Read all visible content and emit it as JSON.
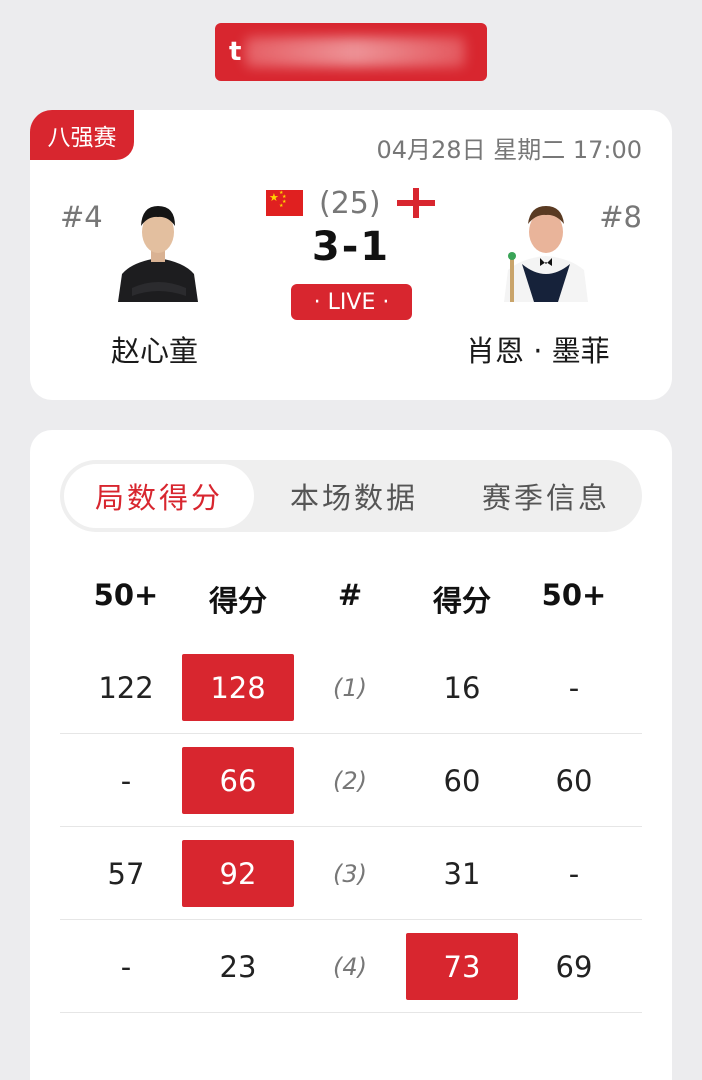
{
  "banner": {
    "text": "t"
  },
  "match": {
    "stage": "八强赛",
    "datetime": "04月28日 星期二 17:00",
    "best_of": "(25)",
    "score": "3-1",
    "live_label": "· LIVE ·",
    "player_left": {
      "seed": "#4",
      "name": "赵心童",
      "flag": "china-flag-icon"
    },
    "player_right": {
      "seed": "#8",
      "name": "肖恩 · 墨菲",
      "flag": "england-flag-icon"
    }
  },
  "stats": {
    "tabs": [
      "局数得分",
      "本场数据",
      "赛季信息"
    ],
    "active_tab": 0,
    "headers": [
      "50+",
      "得分",
      "#",
      "得分",
      "50+"
    ],
    "rows": [
      {
        "left_break": "122",
        "left_score": "128",
        "frame": "(1)",
        "right_score": "16",
        "right_break": "-",
        "winner": "left"
      },
      {
        "left_break": "-",
        "left_score": "66",
        "frame": "(2)",
        "right_score": "60",
        "right_break": "60",
        "winner": "left"
      },
      {
        "left_break": "57",
        "left_score": "92",
        "frame": "(3)",
        "right_score": "31",
        "right_break": "-",
        "winner": "left"
      },
      {
        "left_break": "-",
        "left_score": "23",
        "frame": "(4)",
        "right_score": "73",
        "right_break": "69",
        "winner": "right"
      }
    ]
  },
  "colors": {
    "accent": "#d8262f",
    "background": "#ececee",
    "card": "#ffffff"
  }
}
